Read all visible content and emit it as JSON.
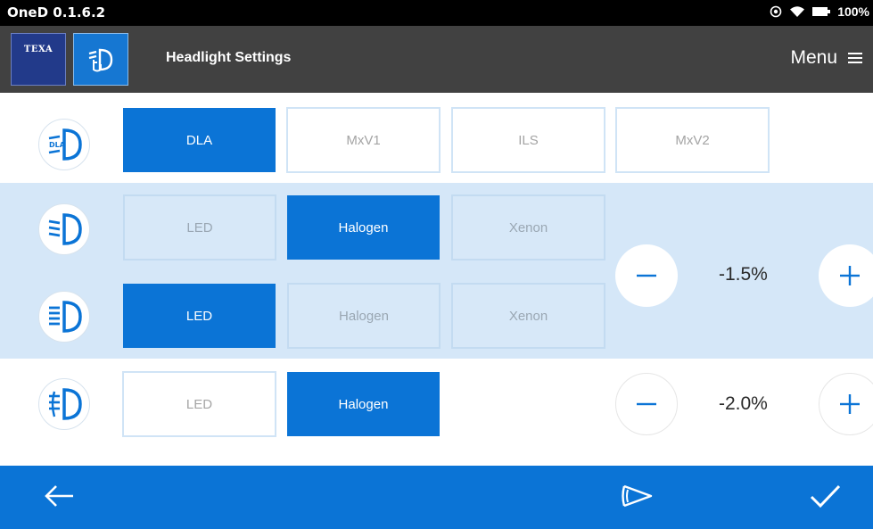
{
  "status": {
    "title": "OneD 0.1.6.2",
    "battery": "100%"
  },
  "header": {
    "logo_text": "TEXA",
    "title": "Headlight Settings",
    "menu_label": "Menu"
  },
  "rows": [
    {
      "icon": "dla-headlight-icon",
      "options": [
        "DLA",
        "MxV1",
        "ILS",
        "MxV2"
      ],
      "selected": "DLA"
    },
    {
      "icon": "low-beam-icon",
      "options": [
        "LED",
        "Halogen",
        "Xenon"
      ],
      "selected": "Halogen"
    },
    {
      "icon": "high-beam-icon",
      "options": [
        "LED",
        "Halogen",
        "Xenon"
      ],
      "selected": "LED"
    },
    {
      "icon": "fog-light-icon",
      "options": [
        "LED",
        "Halogen"
      ],
      "selected": "Halogen"
    }
  ],
  "adjusters": [
    {
      "value": "-1.5%"
    },
    {
      "value": "-2.0%"
    }
  ],
  "colors": {
    "accent": "#0b74d6",
    "row_highlight": "#d5e7f8",
    "appbar": "#414141",
    "logo_bg": "#223a8a"
  }
}
